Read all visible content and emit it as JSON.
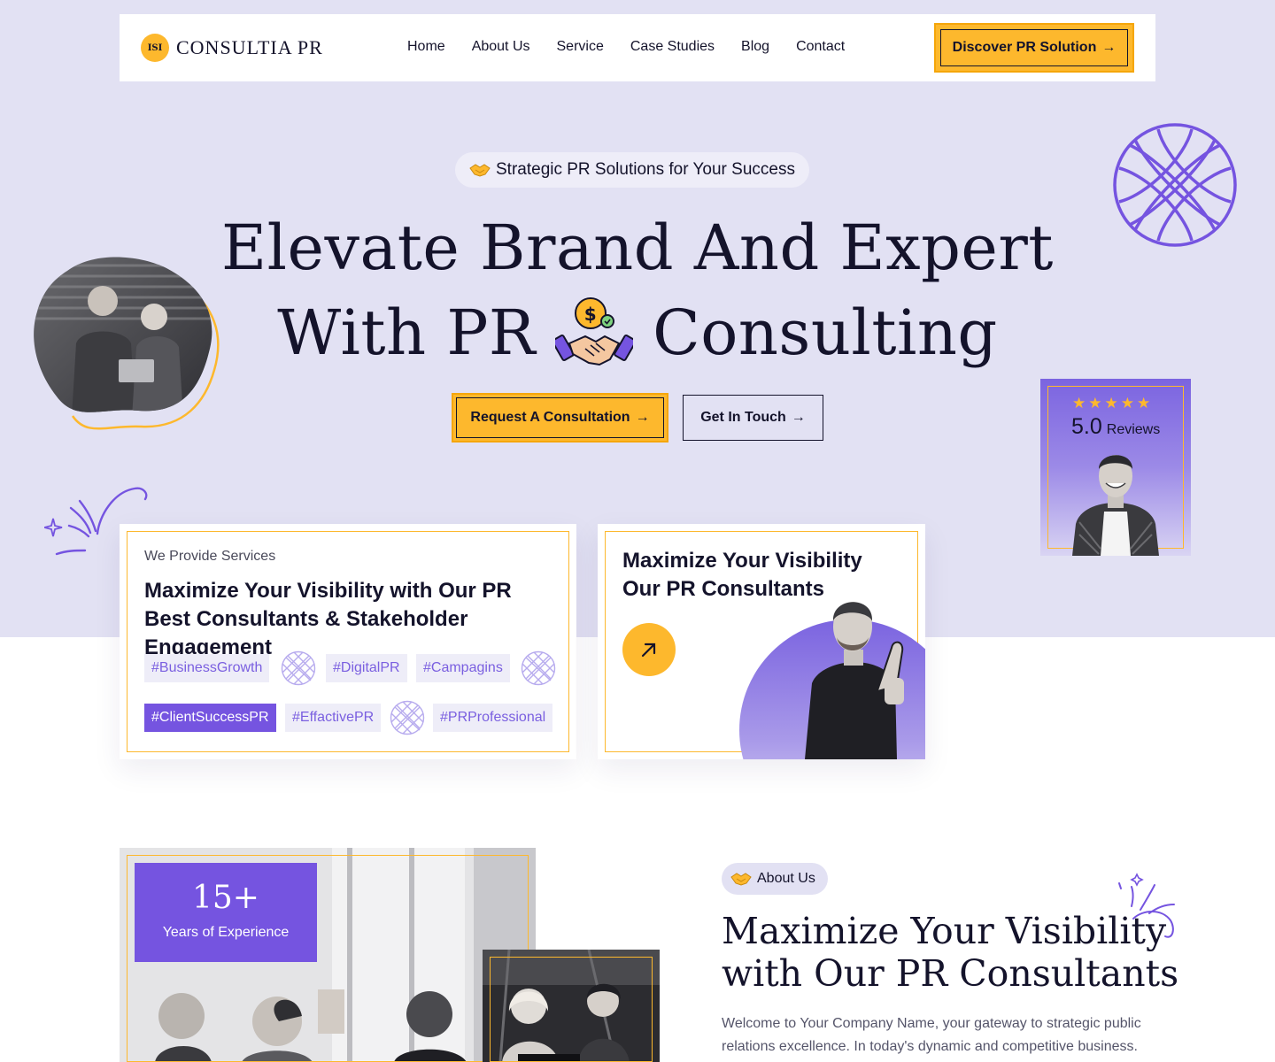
{
  "nav": {
    "logo_mark": "ISI",
    "brand": "CONSULTIA PR",
    "menu": [
      "Home",
      "About Us",
      "Service",
      "Case Studies",
      "Blog",
      "Contact"
    ],
    "cta": "Discover PR Solution"
  },
  "hero": {
    "tag": "Strategic PR Solutions for Your Success",
    "title_line1": "Elevate Brand And Expert",
    "title_line2_a": "With PR",
    "title_line2_b": "Consulting",
    "btn_primary": "Request A Consultation",
    "btn_secondary": "Get In Touch",
    "arrow": "→"
  },
  "review": {
    "stars": "★★★★★",
    "score": "5.0",
    "label": "Reviews"
  },
  "services_card": {
    "kicker": "We Provide Services",
    "title": "Maximize Your Visibility with Our PR Best Consultants & Stakeholder Engagement",
    "tags": [
      "#BusinessGrowth",
      "#DigitalPR",
      "#Campagins",
      "#ClientSuccessPR",
      "#EffactivePR",
      "#PRProfessional"
    ]
  },
  "visibility_card": {
    "title": "Maximize Your Visibility Our PR Consultants",
    "arrow": "↗"
  },
  "about": {
    "years": "15+",
    "years_label": "Years of Experience",
    "pill": "About Us",
    "title": "Maximize Your Visibility with Our PR Consultants",
    "text": "Welcome to Your Company Name, your gateway to strategic public relations excellence. In today's dynamic and competitive business."
  },
  "colors": {
    "accent_yellow": "#fdb82d",
    "accent_purple": "#7554e0",
    "hero_bg": "#e2e1f3",
    "ink": "#14132b"
  },
  "icons": [
    "handshake-icon",
    "arrow-right-icon",
    "arrow-up-right-icon",
    "globe-pattern-icon",
    "sparkle-icon",
    "star-icon",
    "dollar-handshake-icon"
  ]
}
